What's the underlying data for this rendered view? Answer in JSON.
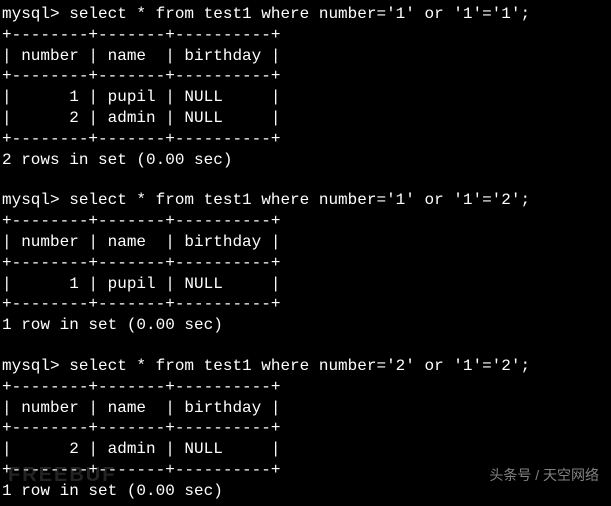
{
  "queries": [
    {
      "prompt": "mysql> select * from test1 where number='1' or '1'='1';",
      "border": "+--------+-------+----------+",
      "header": "| number | name  | birthday |",
      "rows": [
        "|      1 | pupil | NULL     |",
        "|      2 | admin | NULL     |"
      ],
      "result": "2 rows in set (0.00 sec)"
    },
    {
      "prompt": "mysql> select * from test1 where number='1' or '1'='2';",
      "border": "+--------+-------+----------+",
      "header": "| number | name  | birthday |",
      "rows": [
        "|      1 | pupil | NULL     |"
      ],
      "result": "1 row in set (0.00 sec)"
    },
    {
      "prompt": "mysql> select * from test1 where number='2' or '1'='2';",
      "border": "+--------+-------+----------+",
      "header": "| number | name  | birthday |",
      "rows": [
        "|      2 | admin | NULL     |"
      ],
      "result": "1 row in set (0.00 sec)"
    }
  ],
  "watermark_text": "头条号 / 天空网络",
  "watermark_logo": "FREEBUF"
}
